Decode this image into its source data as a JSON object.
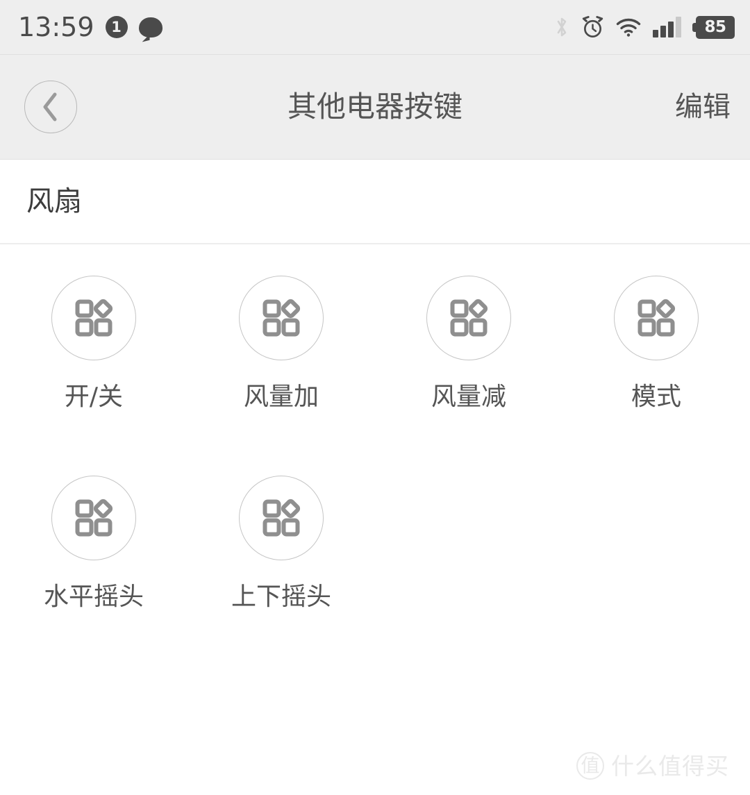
{
  "status_bar": {
    "time": "13:59",
    "notification_count": "1",
    "chat_icon": "chat-bubble-icon",
    "bluetooth_icon": "bluetooth-icon",
    "alarm_icon": "alarm-clock-icon",
    "wifi_icon": "wifi-icon",
    "signal_icon": "cellular-signal-icon",
    "battery_level": "85"
  },
  "nav_bar": {
    "back_icon": "chevron-left-icon",
    "title": "其他电器按键",
    "edit_label": "编辑"
  },
  "section": {
    "title": "风扇"
  },
  "keys": [
    {
      "label": "开/关",
      "icon": "four-squares-icon"
    },
    {
      "label": "风量加",
      "icon": "four-squares-icon"
    },
    {
      "label": "风量减",
      "icon": "four-squares-icon"
    },
    {
      "label": "模式",
      "icon": "four-squares-icon"
    },
    {
      "label": "水平摇头",
      "icon": "four-squares-icon"
    },
    {
      "label": "上下摇头",
      "icon": "four-squares-icon"
    }
  ],
  "watermark": {
    "mark": "值",
    "text": "什么值得买"
  },
  "colors": {
    "status_bg": "#eeeeee",
    "nav_bg": "#eeeeee",
    "content_bg": "#ffffff",
    "icon_gray": "#8f8f8f",
    "text_gray": "#555555",
    "circle_border": "#c5c5c5",
    "status_dark": "#4a4a4a"
  }
}
